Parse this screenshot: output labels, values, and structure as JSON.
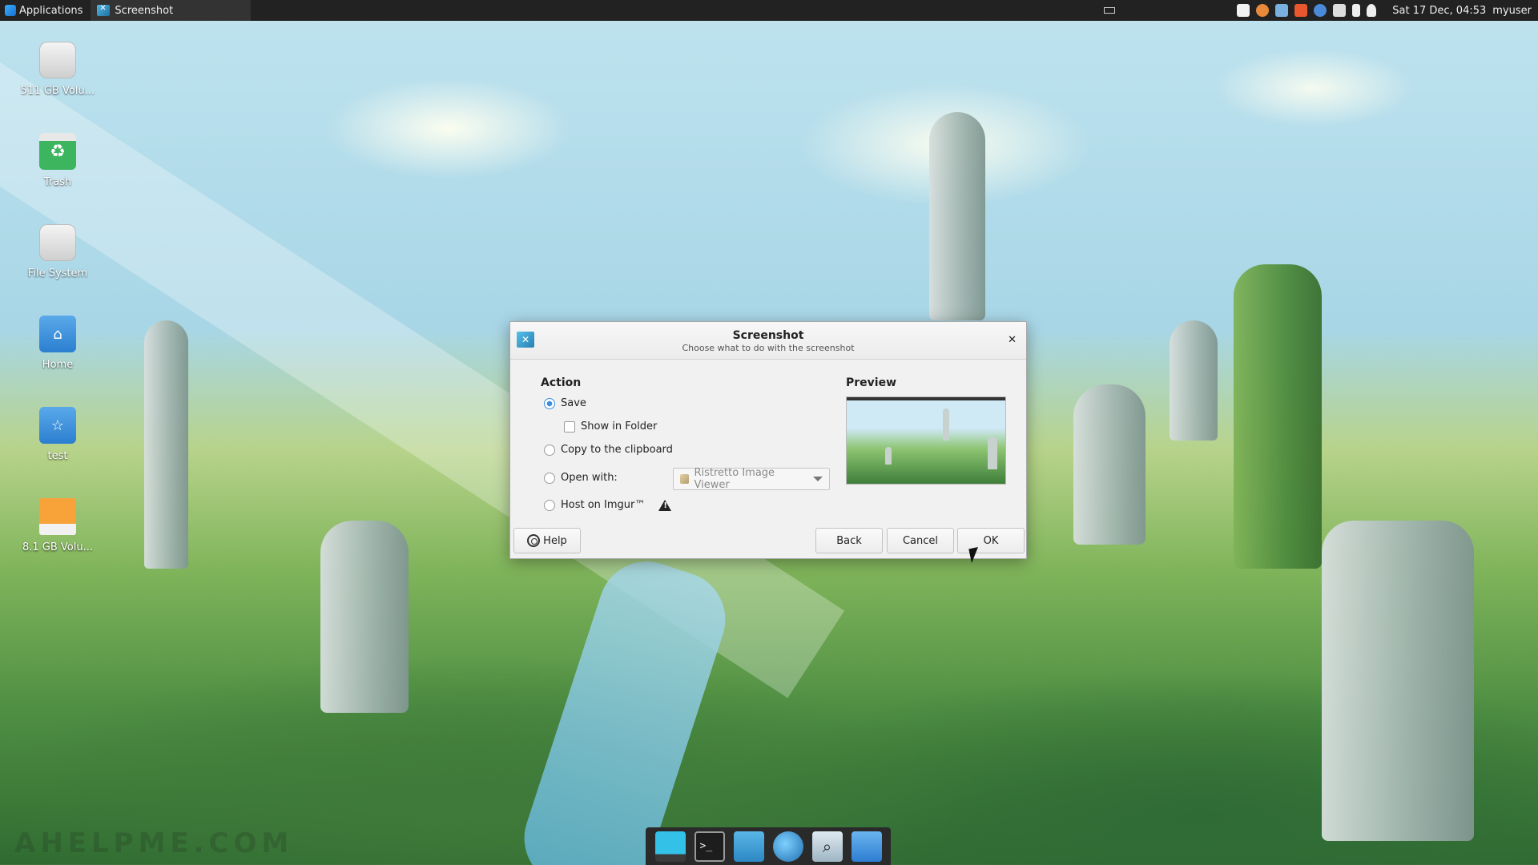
{
  "panel": {
    "apps_label": "Applications",
    "task_label": "Screenshot",
    "clock": "Sat 17 Dec, 04:53",
    "user": "myuser"
  },
  "desktop": {
    "icons": [
      {
        "label": "511 GB Volu...",
        "icon": "drive-icon"
      },
      {
        "label": "Trash",
        "icon": "trash-icon"
      },
      {
        "label": "File System",
        "icon": "drive-icon"
      },
      {
        "label": "Home",
        "icon": "home-folder-icon"
      },
      {
        "label": "test",
        "icon": "star-folder-icon"
      },
      {
        "label": "8.1 GB Volu...",
        "icon": "usb-drive-icon"
      }
    ],
    "watermark": "AHELPME.COM"
  },
  "dialog": {
    "title": "Screenshot",
    "subtitle": "Choose what to do with the screenshot",
    "action_heading": "Action",
    "preview_heading": "Preview",
    "options": {
      "save": {
        "label": "Save",
        "checked": true
      },
      "show_in_folder": {
        "label": "Show in Folder",
        "checked": false
      },
      "clipboard": {
        "label": "Copy to the clipboard",
        "checked": false
      },
      "open_with": {
        "label": "Open with:",
        "checked": false
      },
      "imgur": {
        "label": "Host on Imgur™",
        "checked": false
      }
    },
    "open_with_app": "Ristretto Image Viewer",
    "buttons": {
      "help": "Help",
      "back": "Back",
      "cancel": "Cancel",
      "ok": "OK"
    }
  },
  "colors": {
    "accent": "#3d8ee0",
    "panel_bg": "#222222",
    "dialog_bg": "#f1f1f1"
  }
}
